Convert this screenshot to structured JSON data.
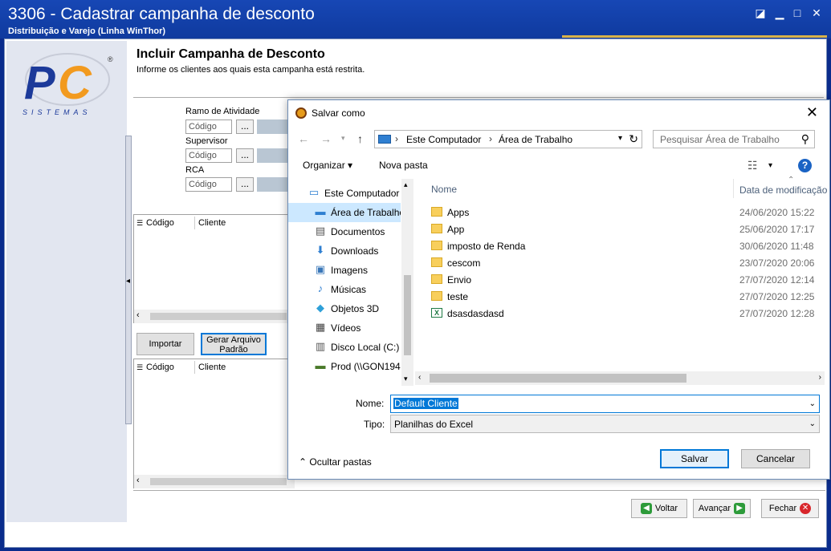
{
  "app": {
    "title": "3306 - Cadastrar campanha de desconto",
    "subtitle": "Distribuição e Varejo (Linha WinThor)",
    "logo_text": "SISTEMAS"
  },
  "header": {
    "title": "Incluir Campanha de Desconto",
    "subtitle": "Informe os clientes aos quais esta campanha está restrita."
  },
  "filters": {
    "ramo_label": "Ramo de Atividade",
    "supervisor_label": "Supervisor",
    "rca_label": "RCA",
    "code_placeholder": "Código",
    "dots": "..."
  },
  "grid": {
    "col_codigo": "Código",
    "col_cliente": "Cliente"
  },
  "buttons": {
    "importar": "Importar",
    "gerar_line1": "Gerar Arquivo",
    "gerar_line2": "Padrão",
    "voltar": "Voltar",
    "avancar": "Avançar",
    "fechar": "Fechar"
  },
  "dialog": {
    "title": "Salvar como",
    "address": [
      "Este Computador",
      "Área de Trabalho"
    ],
    "search_placeholder": "Pesquisar Área de Trabalho",
    "organize": "Organizar",
    "new_folder": "Nova pasta",
    "nav_items": [
      {
        "label": "Este Computador",
        "icon": "computer-icon"
      },
      {
        "label": "Área de Trabalho",
        "icon": "desktop-icon"
      },
      {
        "label": "Documentos",
        "icon": "documents-icon"
      },
      {
        "label": "Downloads",
        "icon": "downloads-icon"
      },
      {
        "label": "Imagens",
        "icon": "images-icon"
      },
      {
        "label": "Músicas",
        "icon": "music-icon"
      },
      {
        "label": "Objetos 3D",
        "icon": "objects3d-icon"
      },
      {
        "label": "Vídeos",
        "icon": "videos-icon"
      },
      {
        "label": "Disco Local (C:)",
        "icon": "drive-icon"
      },
      {
        "label": "Prod (\\\\GON194",
        "icon": "network-drive-icon"
      }
    ],
    "columns": {
      "name": "Nome",
      "date": "Data de modificação"
    },
    "files": [
      {
        "name": "Apps",
        "date": "24/06/2020 15:22",
        "type": "folder"
      },
      {
        "name": "App",
        "date": "25/06/2020 17:17",
        "type": "folder"
      },
      {
        "name": "imposto de Renda",
        "date": "30/06/2020 11:48",
        "type": "folder"
      },
      {
        "name": "cescom",
        "date": "23/07/2020 20:06",
        "type": "folder"
      },
      {
        "name": "Envio",
        "date": "27/07/2020 12:14",
        "type": "folder"
      },
      {
        "name": "teste",
        "date": "27/07/2020 12:25",
        "type": "folder"
      },
      {
        "name": "dsasdasdasd",
        "date": "27/07/2020 12:28",
        "type": "excel"
      }
    ],
    "name_label": "Nome:",
    "name_value": "Default Cliente",
    "type_label": "Tipo:",
    "type_value": "Planilhas do Excel",
    "hide_folders": "Ocultar pastas",
    "save": "Salvar",
    "cancel": "Cancelar"
  },
  "colors": {
    "titlebar": "#1747b5",
    "accent": "#0078d7",
    "selection": "#cce8ff"
  }
}
